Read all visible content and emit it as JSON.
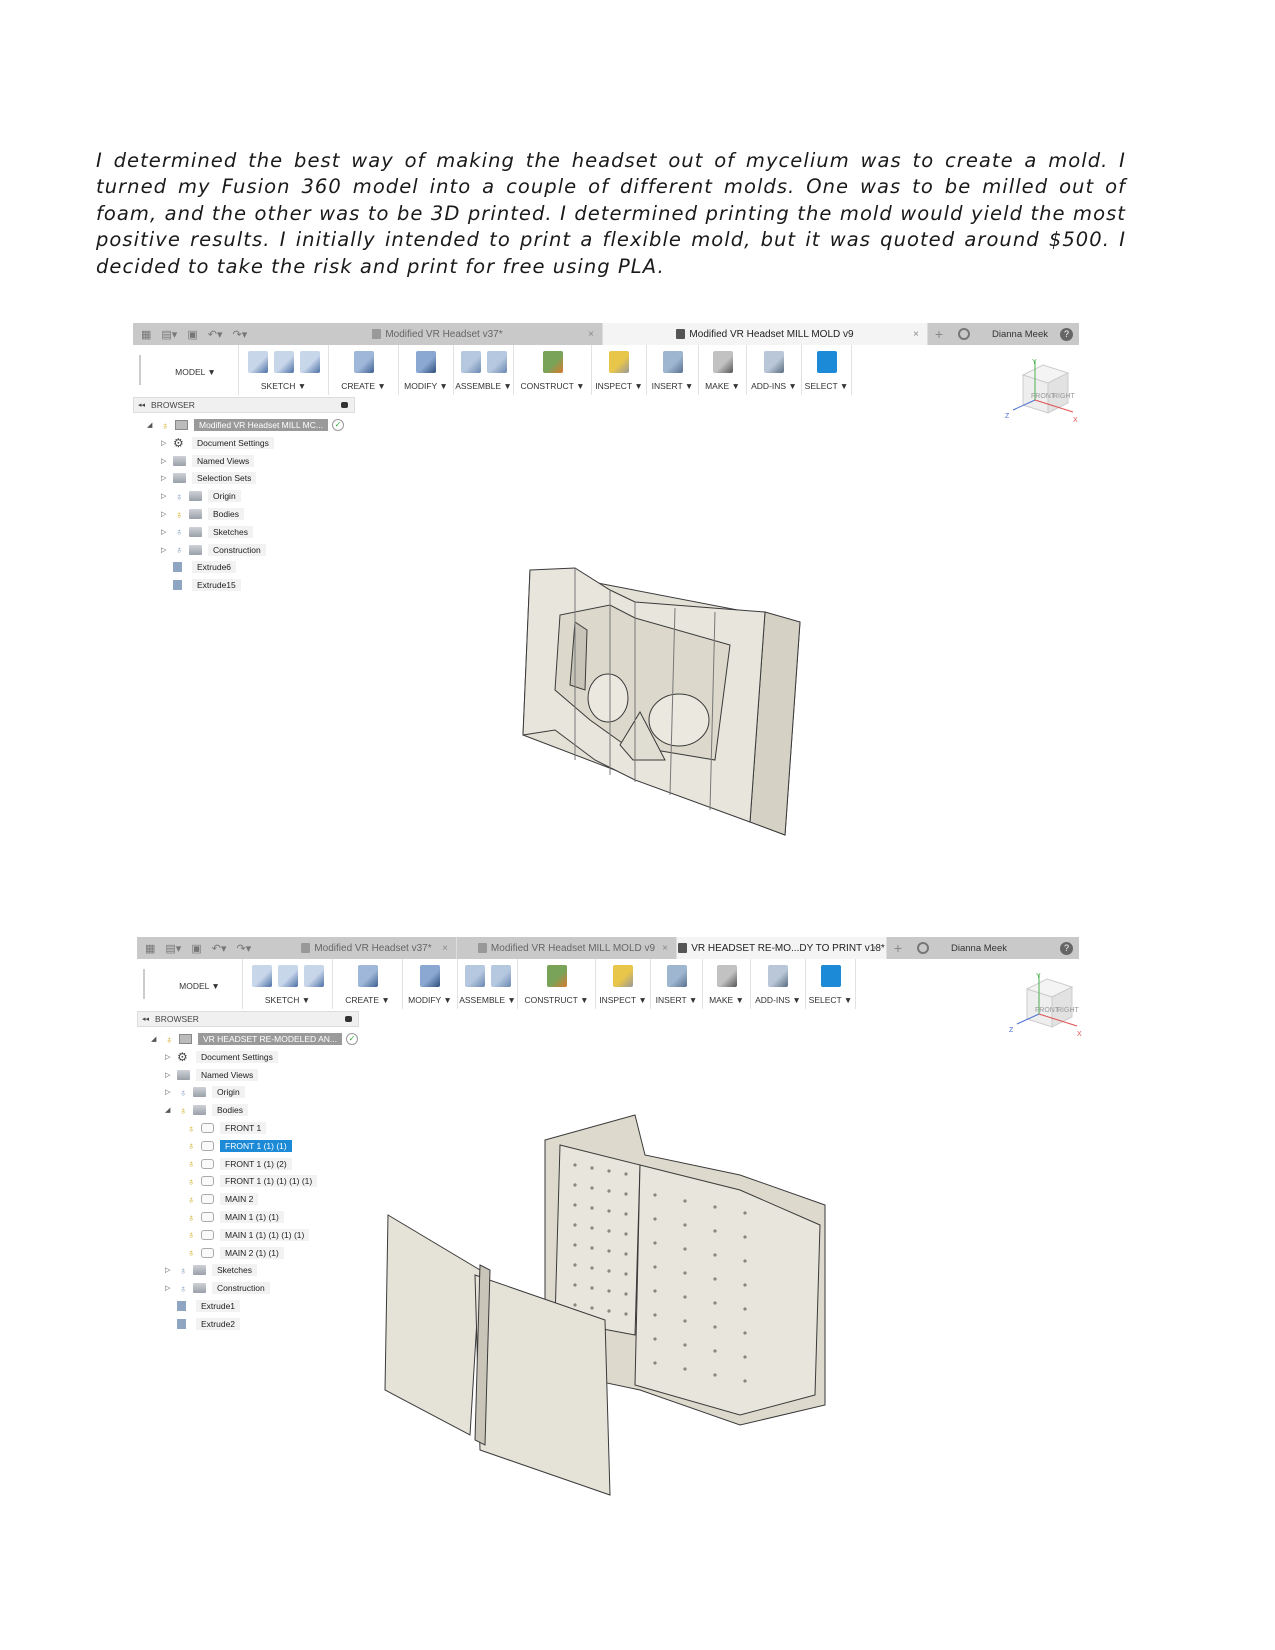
{
  "paragraph": "I determined the best way of making the headset out of mycelium was to create a mold. I turned my Fusion 360 model into a couple of different molds. One was to be milled out of foam, and the other was to be 3D printed. I determined printing the mold would yield the most positive results. I initially intended to print a flexible mold, but it was quoted around $500. I decided to take the risk and print for free using PLA.",
  "colors": {
    "selection": "#1c8ad6",
    "select_button": "#1c8ad6",
    "model_fill": "#e3e0d6",
    "model_edge": "#3a3a3a"
  },
  "screenshots": [
    {
      "tabs": [
        {
          "label": "Modified VR Headset v37*",
          "active": false
        },
        {
          "label": "Modified VR Headset MILL MOLD v9",
          "active": true
        }
      ],
      "user": "Dianna Meek",
      "help": "?",
      "workspace": "MODEL ▼",
      "toolbar": [
        "SKETCH ▼",
        "CREATE ▼",
        "MODIFY ▼",
        "ASSEMBLE ▼",
        "CONSTRUCT ▼",
        "INSPECT ▼",
        "INSERT ▼",
        "MAKE ▼",
        "ADD-INS ▼",
        "SELECT ▼"
      ],
      "browser_label": "BROWSER",
      "viewcube": {
        "front": "FRONT",
        "right": "RIGHT",
        "x": "X",
        "y": "Y",
        "z": "Z"
      },
      "tree": [
        {
          "label": "Modified VR Headset MILL MC...",
          "arrow": "down",
          "bulb": "yellow",
          "icon": "comp",
          "depth": 0,
          "root": true
        },
        {
          "label": "Document Settings",
          "arrow": "right",
          "bulb": "",
          "icon": "gear",
          "depth": 1
        },
        {
          "label": "Named Views",
          "arrow": "right",
          "bulb": "",
          "icon": "folder",
          "depth": 1
        },
        {
          "label": "Selection Sets",
          "arrow": "right",
          "bulb": "",
          "icon": "folder",
          "depth": 1
        },
        {
          "label": "Origin",
          "arrow": "right",
          "bulb": "blue",
          "icon": "folder",
          "depth": 1
        },
        {
          "label": "Bodies",
          "arrow": "right",
          "bulb": "yellow",
          "icon": "folder",
          "depth": 1
        },
        {
          "label": "Sketches",
          "arrow": "right",
          "bulb": "blue",
          "icon": "folder",
          "depth": 1
        },
        {
          "label": "Construction",
          "arrow": "right",
          "bulb": "blue",
          "icon": "folder",
          "depth": 1
        },
        {
          "label": "Extrude6",
          "arrow": "",
          "bulb": "",
          "icon": "extrude",
          "depth": 1
        },
        {
          "label": "Extrude15",
          "arrow": "",
          "bulb": "",
          "icon": "extrude",
          "depth": 1
        }
      ]
    },
    {
      "tabs": [
        {
          "label": "Modified VR Headset v37*",
          "active": false
        },
        {
          "label": "Modified VR Headset MILL MOLD v9",
          "active": false
        },
        {
          "label": "VR HEADSET RE-MO...DY TO PRINT v18*",
          "active": true
        }
      ],
      "user": "Dianna Meek",
      "help": "?",
      "workspace": "MODEL ▼",
      "toolbar": [
        "SKETCH ▼",
        "CREATE ▼",
        "MODIFY ▼",
        "ASSEMBLE ▼",
        "CONSTRUCT ▼",
        "INSPECT ▼",
        "INSERT ▼",
        "MAKE ▼",
        "ADD-INS ▼",
        "SELECT ▼"
      ],
      "browser_label": "BROWSER",
      "viewcube": {
        "front": "FRONT",
        "right": "RIGHT",
        "x": "X",
        "y": "Y",
        "z": "Z"
      },
      "tree": [
        {
          "label": "VR HEADSET RE-MODELED AN...",
          "arrow": "down",
          "bulb": "yellow",
          "icon": "comp",
          "depth": 0,
          "root": true
        },
        {
          "label": "Document Settings",
          "arrow": "right",
          "bulb": "",
          "icon": "gear",
          "depth": 1
        },
        {
          "label": "Named Views",
          "arrow": "right",
          "bulb": "",
          "icon": "folder",
          "depth": 1
        },
        {
          "label": "Origin",
          "arrow": "right",
          "bulb": "blue",
          "icon": "folder",
          "depth": 1
        },
        {
          "label": "Bodies",
          "arrow": "down",
          "bulb": "yellow",
          "icon": "folder",
          "depth": 1
        },
        {
          "label": "FRONT 1",
          "arrow": "",
          "bulb": "yellow",
          "icon": "body",
          "depth": 2
        },
        {
          "label": "FRONT 1 (1) (1)",
          "arrow": "",
          "bulb": "yellow",
          "icon": "body",
          "depth": 2,
          "selected": true
        },
        {
          "label": "FRONT 1 (1) (2)",
          "arrow": "",
          "bulb": "yellow",
          "icon": "body",
          "depth": 2
        },
        {
          "label": "FRONT 1 (1) (1) (1) (1)",
          "arrow": "",
          "bulb": "yellow",
          "icon": "body",
          "depth": 2
        },
        {
          "label": "MAIN 2",
          "arrow": "",
          "bulb": "yellow",
          "icon": "body",
          "depth": 2
        },
        {
          "label": "MAIN 1 (1) (1)",
          "arrow": "",
          "bulb": "yellow",
          "icon": "body",
          "depth": 2
        },
        {
          "label": "MAIN 1 (1) (1) (1) (1)",
          "arrow": "",
          "bulb": "yellow",
          "icon": "body",
          "depth": 2
        },
        {
          "label": "MAIN 2 (1) (1)",
          "arrow": "",
          "bulb": "yellow",
          "icon": "body",
          "depth": 2
        },
        {
          "label": "Sketches",
          "arrow": "right",
          "bulb": "blue",
          "icon": "folder",
          "depth": 1
        },
        {
          "label": "Construction",
          "arrow": "right",
          "bulb": "blue",
          "icon": "folder",
          "depth": 1
        },
        {
          "label": "Extrude1",
          "arrow": "",
          "bulb": "",
          "icon": "extrude",
          "depth": 1
        },
        {
          "label": "Extrude2",
          "arrow": "",
          "bulb": "",
          "icon": "extrude",
          "depth": 1
        }
      ]
    }
  ]
}
